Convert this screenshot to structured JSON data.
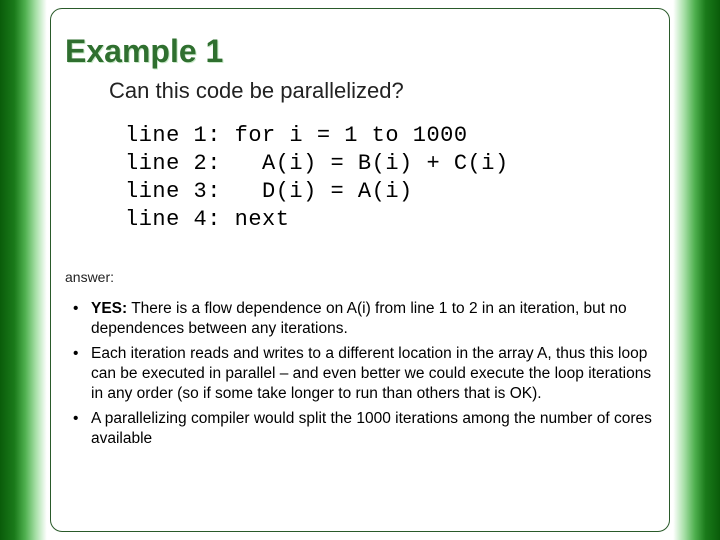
{
  "slide": {
    "title": "Example 1",
    "question": "Can this code be parallelized?",
    "code": {
      "line1": "line 1: for i = 1 to 1000",
      "line2": "line 2:   A(i) = B(i) + C(i)",
      "line3": "line 3:   D(i) = A(i)",
      "line4": "line 4: next"
    },
    "answer_label": "answer:",
    "bullets": {
      "b1_lead": "YES:",
      "b1_rest": " There is a flow dependence on A(i) from line 1 to 2 in an iteration, but no dependences between any iterations.",
      "b2": "Each iteration reads and writes to a different location in the array A, thus this loop can be executed in parallel – and even better we could execute the loop iterations in any order (so if some take longer to run than others that is OK).",
      "b3": "A parallelizing compiler would split the 1000 iterations among the number of cores available"
    }
  }
}
